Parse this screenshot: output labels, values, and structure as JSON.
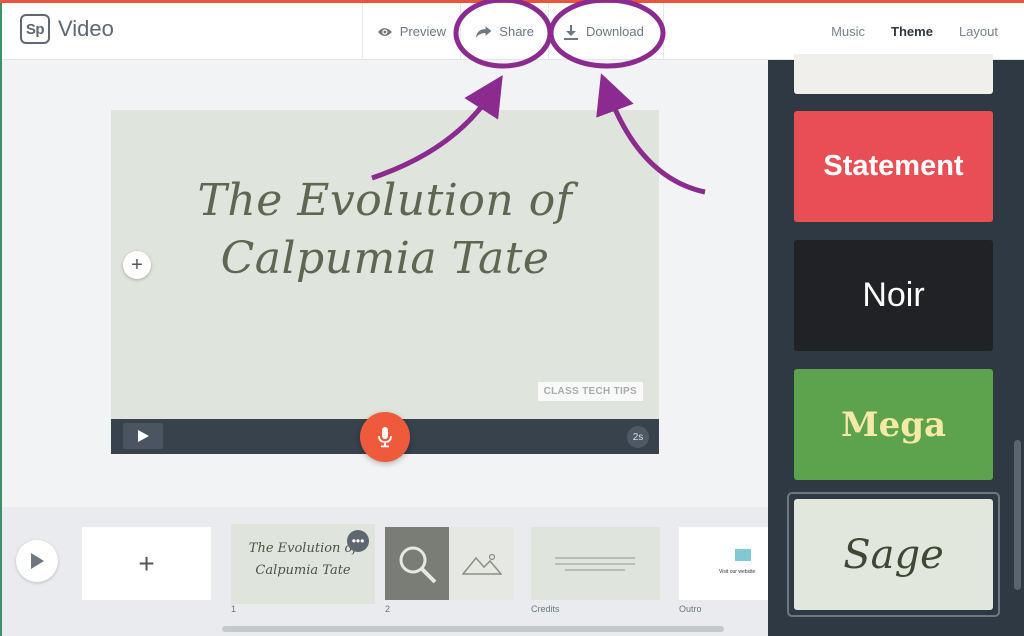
{
  "app": {
    "logo_mark": "Sp",
    "title": "Video"
  },
  "header": {
    "actions": [
      {
        "label": "Preview",
        "icon": "eye-icon"
      },
      {
        "label": "Share",
        "icon": "share-arrow-icon"
      },
      {
        "label": "Download",
        "icon": "download-icon"
      }
    ],
    "tabs": [
      {
        "label": "Music",
        "active": false
      },
      {
        "label": "Theme",
        "active": true
      },
      {
        "label": "Layout",
        "active": false
      }
    ]
  },
  "stage": {
    "title_line1": "The Evolution of",
    "title_line2": "Calpumia Tate",
    "watermark": "CLASS TECH TIPS",
    "duration": "2s"
  },
  "themes": [
    {
      "name": "Statement",
      "bg": "#e84f55"
    },
    {
      "name": "Noir",
      "bg": "#212226"
    },
    {
      "name": "Mega",
      "bg": "#5da34d"
    },
    {
      "name": "Sage",
      "bg": "#e2e7de",
      "selected": true
    }
  ],
  "filmstrip": {
    "thumbs": [
      {
        "label": "1",
        "line1": "The Evolution of",
        "line2": "Calpumia Tate"
      },
      {
        "label": "2"
      },
      {
        "label": "Credits"
      },
      {
        "label": "Outro",
        "text": "Visit our website"
      }
    ]
  },
  "colors": {
    "accent": "#e8553c",
    "annotation": "#8b2a8f",
    "mic": "#ef5a3c"
  }
}
